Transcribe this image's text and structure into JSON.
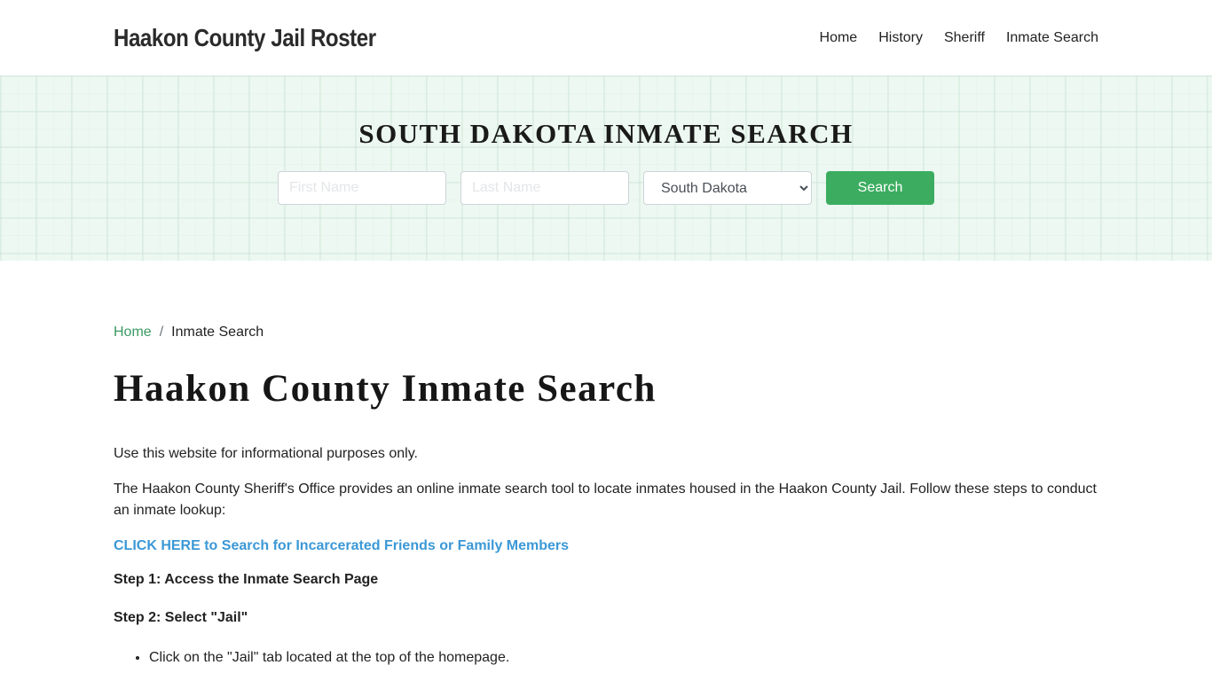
{
  "header": {
    "brand": "Haakon County Jail Roster",
    "nav": [
      {
        "label": "Home"
      },
      {
        "label": "History"
      },
      {
        "label": "Sheriff"
      },
      {
        "label": "Inmate Search"
      }
    ]
  },
  "hero": {
    "title": "SOUTH DAKOTA INMATE SEARCH",
    "first_name_placeholder": "First Name",
    "first_name_value": "",
    "last_name_placeholder": "Last Name",
    "last_name_value": "",
    "state_selected": "South Dakota",
    "search_label": "Search",
    "accent_color": "#3cad60"
  },
  "breadcrumb": {
    "home": "Home",
    "separator": "/",
    "current": "Inmate Search"
  },
  "main": {
    "title": "Haakon County Inmate Search",
    "intro": "Use this website for informational purposes only.",
    "description": "The Haakon County Sheriff's Office provides an online inmate search tool to locate inmates housed in the Haakon County Jail. Follow these steps to conduct an inmate lookup:",
    "cta_link": "CLICK HERE to Search for Incarcerated Friends or Family Members",
    "step1": "Step 1: Access the Inmate Search Page",
    "step2": "Step 2: Select \"Jail\"",
    "bullets": [
      "Click on the \"Jail\" tab located at the top of the homepage."
    ]
  }
}
